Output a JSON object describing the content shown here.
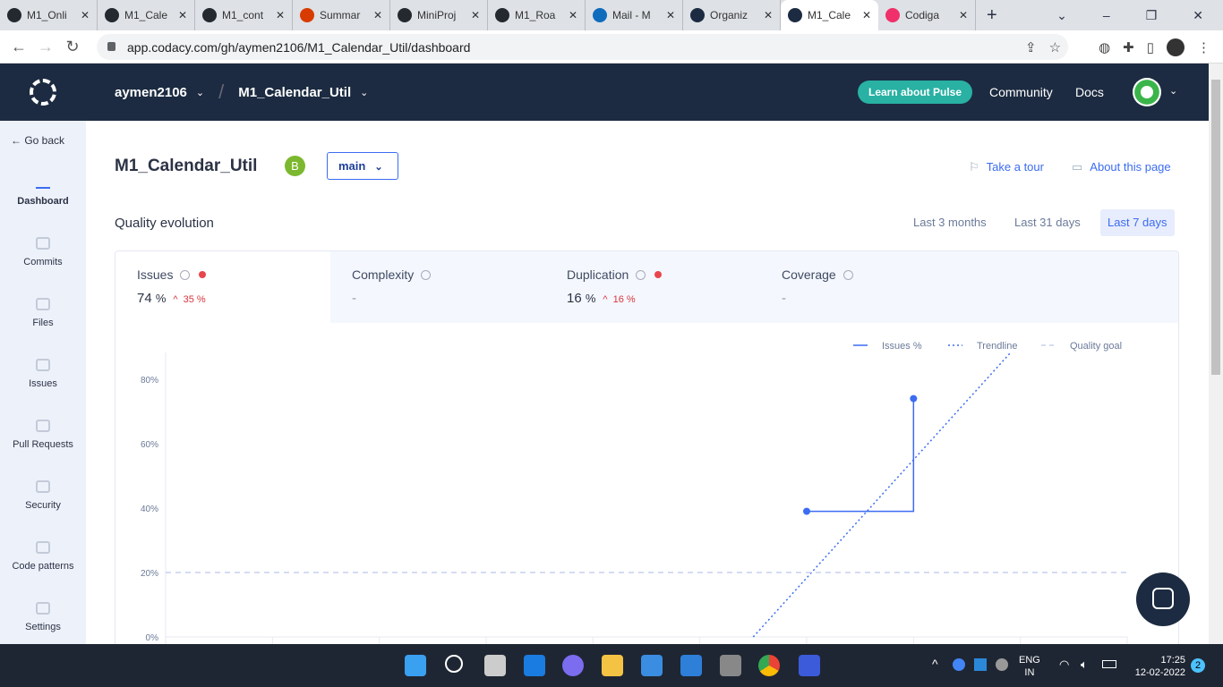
{
  "browser": {
    "tabs": [
      {
        "title": "M1_Onli",
        "color": "#24292f"
      },
      {
        "title": "M1_Cale",
        "color": "#24292f"
      },
      {
        "title": "M1_cont",
        "color": "#24292f"
      },
      {
        "title": "Summar",
        "color": "#d83b01"
      },
      {
        "title": "MiniProj",
        "color": "#24292f"
      },
      {
        "title": "M1_Roa",
        "color": "#24292f"
      },
      {
        "title": "Mail - M",
        "color": "#0f6cbd"
      },
      {
        "title": "Organiz",
        "color": "#1c2b41"
      },
      {
        "title": "M1_Cale",
        "color": "#1c2b41",
        "active": true
      },
      {
        "title": "Codiga",
        "color": "#f0306a"
      }
    ],
    "close": "✕",
    "new_tab": "+",
    "url": "app.codacy.com/gh/aymen2106/M1_Calendar_Util/dashboard"
  },
  "header": {
    "org": "aymen2106",
    "repo": "M1_Calendar_Util",
    "pulse": "Learn about Pulse",
    "community": "Community",
    "docs": "Docs"
  },
  "sidebar": {
    "go_back": "← Go back",
    "items": [
      {
        "label": "Dashboard",
        "active": true
      },
      {
        "label": "Commits"
      },
      {
        "label": "Files"
      },
      {
        "label": "Issues"
      },
      {
        "label": "Pull Requests"
      },
      {
        "label": "Security"
      },
      {
        "label": "Code patterns"
      },
      {
        "label": "Settings"
      }
    ]
  },
  "page": {
    "title": "M1_Calendar_Util",
    "grade": "B",
    "branch": "main",
    "take_tour": "Take a tour",
    "about": "About this page",
    "section": "Quality evolution",
    "ranges": [
      "Last 3 months",
      "Last 31 days",
      "Last 7 days"
    ],
    "active_range": "Last 7 days"
  },
  "metrics": [
    {
      "label": "Issues",
      "value": "74",
      "unit": "%",
      "delta": "35",
      "delta_unit": "%",
      "alert": true
    },
    {
      "label": "Complexity",
      "value": "-"
    },
    {
      "label": "Duplication",
      "value": "16",
      "unit": "%",
      "delta": "16",
      "delta_unit": "%",
      "alert": true
    },
    {
      "label": "Coverage",
      "value": "-"
    }
  ],
  "chart_data": {
    "type": "line",
    "ylim": [
      0,
      80
    ],
    "yticks": [
      "0%",
      "20%",
      "40%",
      "60%",
      "80%"
    ],
    "legend": [
      "Issues %",
      "Trendline",
      "Quality goal"
    ],
    "legend_position": "top-right",
    "x_count": 10,
    "series": [
      {
        "name": "Issues %",
        "style": "step",
        "points": [
          [
            6,
            39
          ],
          [
            7,
            39
          ],
          [
            7,
            74
          ]
        ]
      },
      {
        "name": "Trendline",
        "style": "dotted",
        "points": [
          [
            5.5,
            0
          ],
          [
            7.9,
            88
          ]
        ]
      },
      {
        "name": "Quality goal",
        "style": "dashed",
        "value": 20
      }
    ],
    "colors": {
      "issues": "#3b6cf2",
      "goal": "#c5d0ee"
    }
  },
  "taskbar": {
    "lang": "ENG",
    "region": "IN",
    "time": "17:25",
    "date": "12-02-2022",
    "notifications": "2"
  }
}
